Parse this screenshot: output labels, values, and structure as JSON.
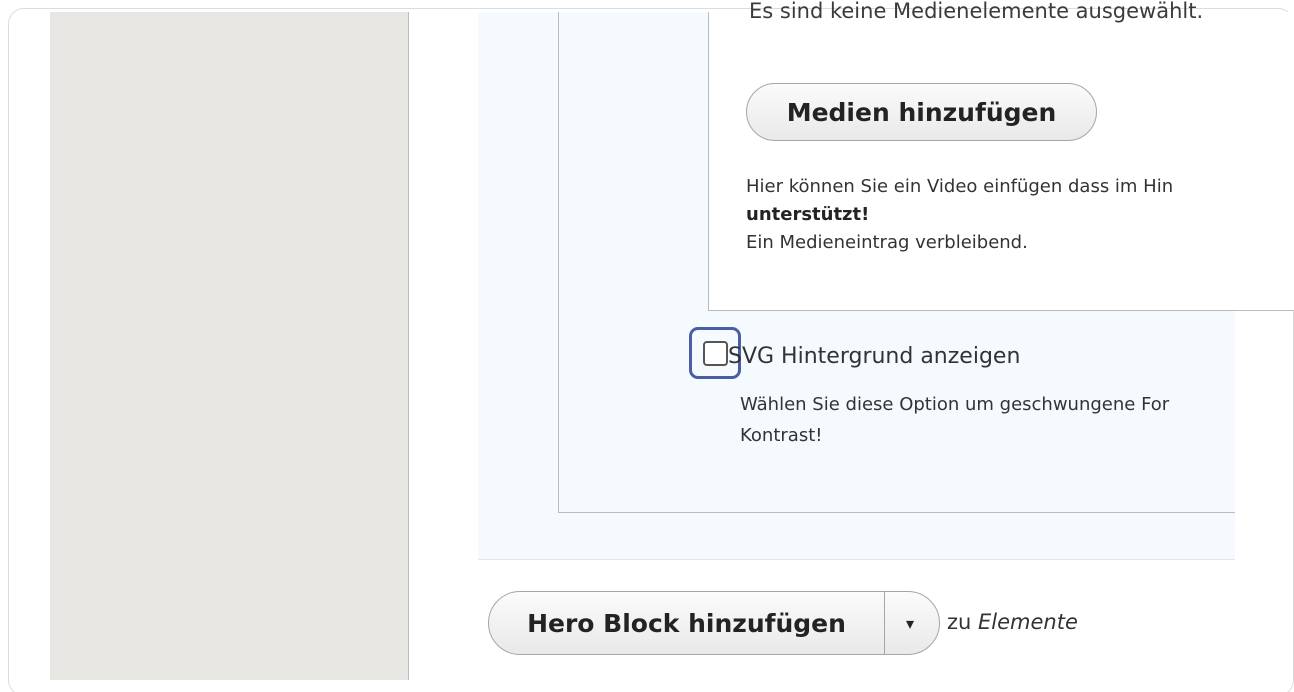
{
  "media_widget": {
    "empty_message": "Es sind keine Medienelemente ausgewählt.",
    "add_media_button": "Medien hinzufügen",
    "help_text_line1": "Hier können Sie ein Video einfügen dass im Hin",
    "help_text_bold": "unterstützt!",
    "remaining_text": "Ein Medieneintrag verbleibend."
  },
  "svg_option": {
    "checked": false,
    "label": "SVG Hintergrund anzeigen",
    "description_line1": "Wählen Sie diese Option um geschwungene For",
    "description_line2": "Kontrast!"
  },
  "add_block": {
    "button_label": "Hero Block hinzufügen",
    "dropdown_icon": "caret-down-icon",
    "suffix_prefix": "zu",
    "suffix_target": "Elemente"
  },
  "colors": {
    "panel_background": "#f5faff",
    "focus_ring": "#4a5ea8",
    "sidebar_background": "#e8e6e3"
  }
}
